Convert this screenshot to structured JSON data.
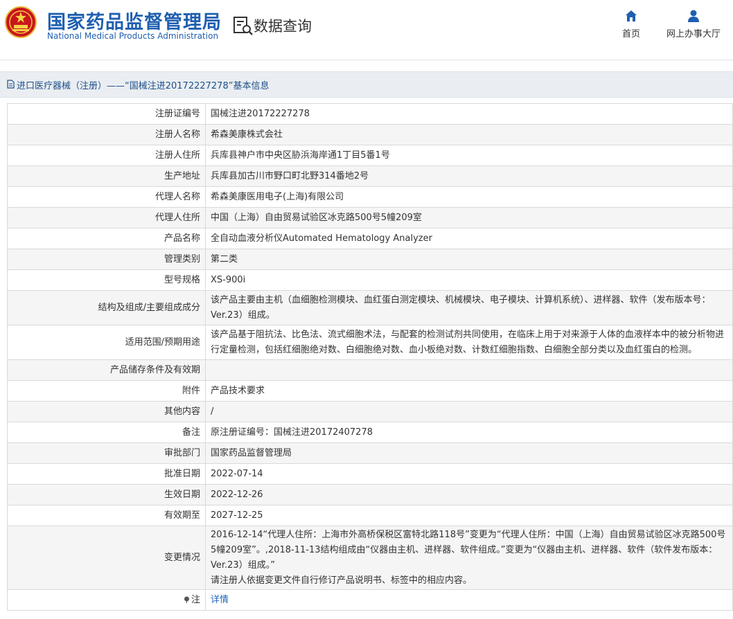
{
  "site": {
    "agency_cn": "国家药品监督管理局",
    "agency_en": "National Medical Products Administration",
    "section_title": "数据查询",
    "nav": [
      {
        "label": "首页",
        "icon": "home-icon"
      },
      {
        "label": "网上办事大厅",
        "icon": "user-icon"
      }
    ],
    "brand_color": "#1f5fb0"
  },
  "breadcrumb": "进口医疗器械（注册）——“国械注进20172227278”基本信息",
  "rows": [
    {
      "label": "注册证编号",
      "value": "国械注进20172227278"
    },
    {
      "label": "注册人名称",
      "value": "希森美康株式会社"
    },
    {
      "label": "注册人住所",
      "value": "兵库县神户市中央区胁浜海岸通1丁目5番1号"
    },
    {
      "label": "生产地址",
      "value": "兵库县加古川市野口町北野314番地2号"
    },
    {
      "label": "代理人名称",
      "value": "希森美康医用电子(上海)有限公司"
    },
    {
      "label": "代理人住所",
      "value": "中国（上海）自由贸易试验区冰克路500号5幢209室"
    },
    {
      "label": "产品名称",
      "value": "全自动血液分析仪Automated Hematology Analyzer"
    },
    {
      "label": "管理类别",
      "value": "第二类"
    },
    {
      "label": "型号规格",
      "value": "XS-900i"
    },
    {
      "label": "结构及组成/主要组成成分",
      "value": "该产品主要由主机（血细胞检测模块、血红蛋白测定模块、机械模块、电子模块、计算机系统）、进样器、软件（发布版本号：Ver.23）组成。"
    },
    {
      "label": "适用范围/预期用途",
      "value": "该产品基于阻抗法、比色法、流式细胞术法，与配套的检测试剂共同使用，在临床上用于对来源于人体的血液样本中的被分析物进行定量检测，包括红细胞绝对数、白细胞绝对数、血小板绝对数、计数红细胞指数、白细胞全部分类以及血红蛋白的检测。"
    },
    {
      "label": "产品储存条件及有效期",
      "value": ""
    },
    {
      "label": "附件",
      "value": "产品技术要求"
    },
    {
      "label": "其他内容",
      "value": "/"
    },
    {
      "label": "备注",
      "value": "原注册证编号：国械注进20172407278"
    },
    {
      "label": "审批部门",
      "value": "国家药品监督管理局"
    },
    {
      "label": "批准日期",
      "value": "2022-07-14"
    },
    {
      "label": "生效日期",
      "value": "2022-12-26"
    },
    {
      "label": "有效期至",
      "value": "2027-12-25"
    }
  ],
  "change": {
    "label": "变更情况",
    "text": "2016-12-14“代理人住所：上海市外高桥保税区富特北路118号”变更为“代理人住所：中国（上海）自由贸易试验区冰克路500号5幢209室”。,2018-11-13结构组成由“仪器由主机、进样器、软件组成。”变更为“仪器由主机、进样器、软件（软件发布版本：Ver.23）组成。”",
    "note": "请注册人依据变更文件自行修订产品说明书、标签中的相应内容。"
  },
  "footnote": {
    "label": "注",
    "link": "详情"
  }
}
